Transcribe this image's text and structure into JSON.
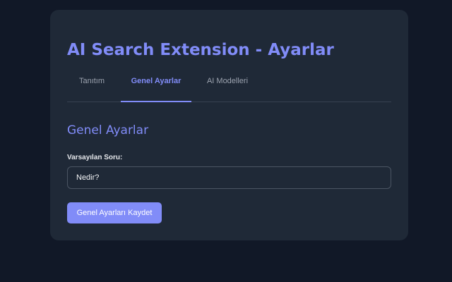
{
  "header": {
    "title": "AI Search Extension - Ayarlar"
  },
  "tabs": [
    {
      "label": "Tanıtım",
      "active": false
    },
    {
      "label": "Genel Ayarlar",
      "active": true
    },
    {
      "label": "AI Modelleri",
      "active": false
    }
  ],
  "section": {
    "title": "Genel Ayarlar",
    "default_question_label": "Varsayılan Soru:",
    "default_question_value": "Nedir?",
    "save_label": "Genel Ayarları Kaydet"
  },
  "colors": {
    "background": "#111827",
    "card": "#1f2937",
    "accent": "#818cf8",
    "border": "#4b5563"
  }
}
